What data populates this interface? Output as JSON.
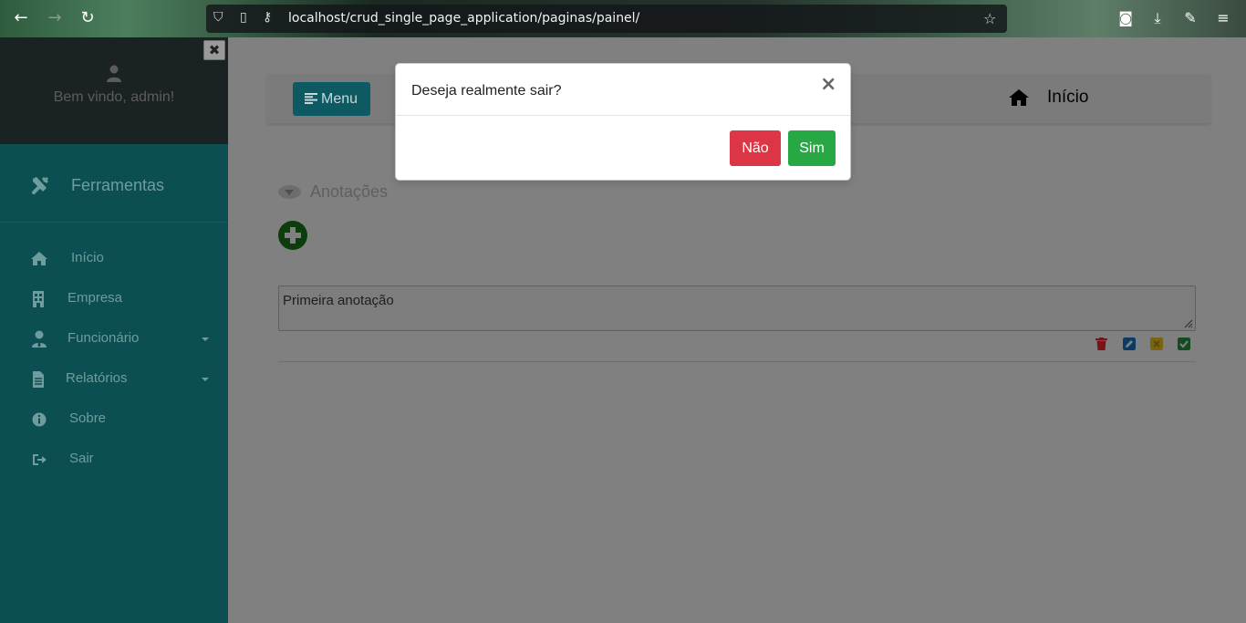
{
  "browser": {
    "url": "localhost/crud_single_page_application/paginas/painel/"
  },
  "sidebar": {
    "welcome": "Bem vindo, admin!",
    "close_label": "✖",
    "tools_label": "Ferramentas",
    "items": [
      {
        "label": "Início",
        "icon": "home-icon"
      },
      {
        "label": "Empresa",
        "icon": "building-icon"
      },
      {
        "label": "Funcionário",
        "icon": "user-tie-icon",
        "has_submenu": true
      },
      {
        "label": "Relatórios",
        "icon": "file-icon",
        "has_submenu": true
      },
      {
        "label": "Sobre",
        "icon": "info-icon"
      },
      {
        "label": "Sair",
        "icon": "sign-out-icon"
      }
    ]
  },
  "topbar": {
    "menu_label": "Menu",
    "home_label": "Início"
  },
  "notes": {
    "title": "Anotações",
    "items": [
      {
        "text": "Primeira anotação"
      }
    ]
  },
  "modal": {
    "title": "Deseja realmente sair?",
    "close": "×",
    "no_label": "Não",
    "yes_label": "Sim"
  },
  "colors": {
    "sidebar_bg": "#0b4f52",
    "btn_no": "#dc3545",
    "btn_yes": "#28a745",
    "menu_btn": "#0d5a63"
  }
}
